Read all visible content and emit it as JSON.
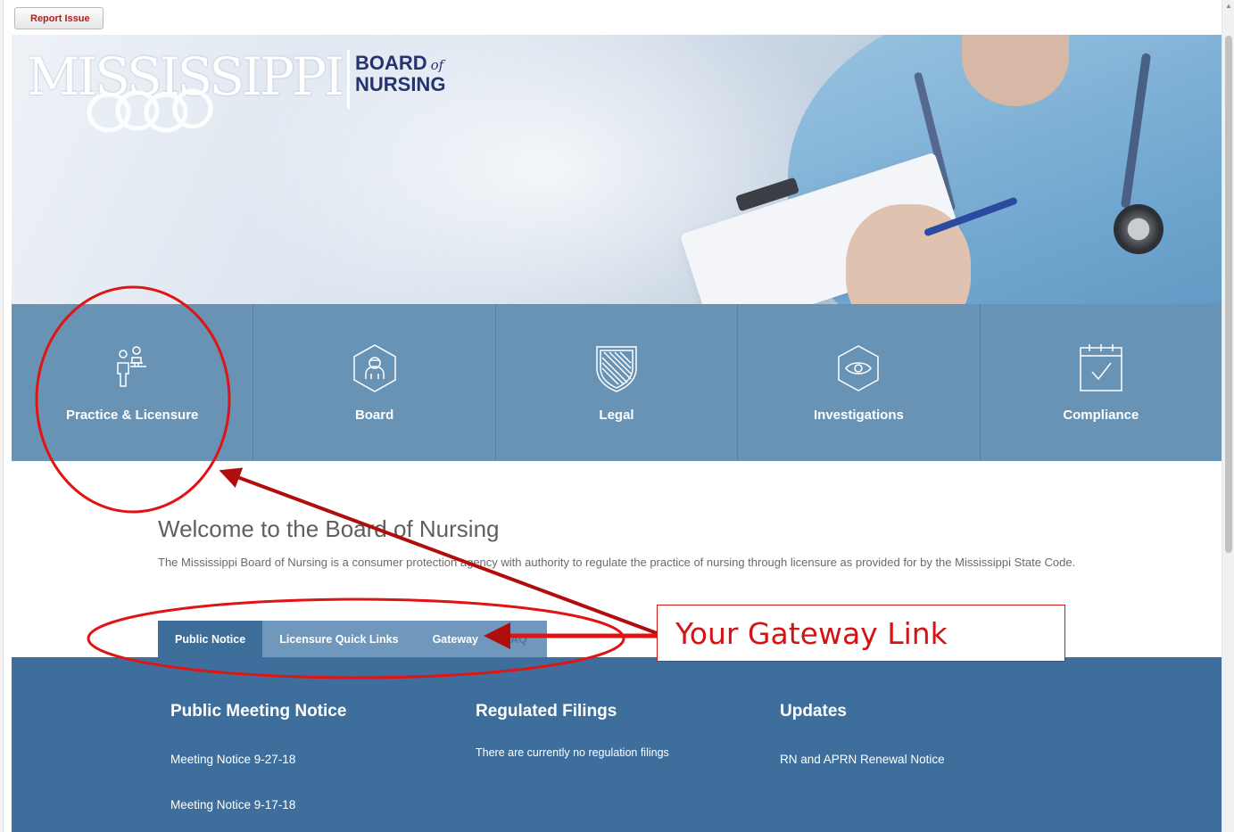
{
  "toolbar": {
    "report_issue_label": "Report Issue"
  },
  "logo": {
    "state_text": "MISSISSIPPI",
    "board_text": "BOARD",
    "of_text": "of",
    "nursing_text": "NURSING"
  },
  "nav_tiles": [
    {
      "label": "Practice & Licensure",
      "icon": "people-podium-icon"
    },
    {
      "label": "Board",
      "icon": "hexagon-person-icon"
    },
    {
      "label": "Legal",
      "icon": "shield-icon"
    },
    {
      "label": "Investigations",
      "icon": "eye-icon"
    },
    {
      "label": "Compliance",
      "icon": "calendar-check-icon"
    }
  ],
  "welcome": {
    "title": "Welcome to the Board of Nursing",
    "text": "The Mississippi Board of Nursing is a consumer protection agency  with authority to regulate the practice of nursing through licensure as provided for by the Mississippi State Code."
  },
  "tabs": [
    {
      "label": "Public Notice",
      "active": true
    },
    {
      "label": "Licensure Quick Links",
      "active": false
    },
    {
      "label": "Gateway",
      "active": false
    },
    {
      "label": "FAQ",
      "active": false
    }
  ],
  "panel": {
    "public_meeting": {
      "heading": "Public Meeting Notice",
      "items": [
        "Meeting Notice 9-27-18",
        "Meeting Notice 9-17-18"
      ]
    },
    "regulated_filings": {
      "heading": "Regulated Filings",
      "items": [
        "There are currently no regulation filings"
      ]
    },
    "updates": {
      "heading": "Updates",
      "items": [
        "RN and APRN Renewal Notice"
      ]
    }
  },
  "annotation": {
    "callout_text": "Your Gateway Link",
    "color": "#d21414"
  },
  "colors": {
    "tile_bg": "#6993b5",
    "panel_bg": "#3e6f9c",
    "tab_active": "#3d6e9a",
    "tab_inactive": "#6f98bc"
  }
}
